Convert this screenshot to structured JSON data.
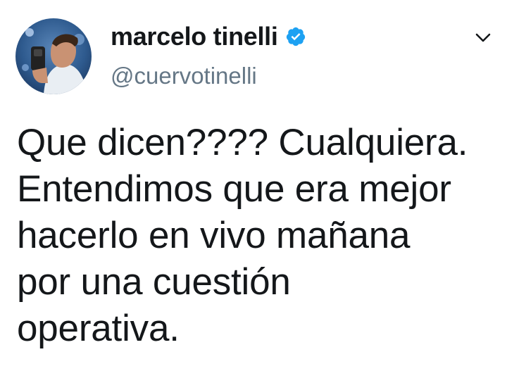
{
  "tweet": {
    "author": {
      "display_name": "marcelo tinelli",
      "handle": "@cuervotinelli",
      "verified": true,
      "avatar_icon": "user-avatar-photo"
    },
    "menu_icon": "chevron-down-icon",
    "text": "Que dicen???? Cualquiera.\nEntendimos que era mejor\nhacerlo en vivo mañana\npor una cuestión\noperativa.",
    "colors": {
      "verified_badge": "#1da1f2",
      "handle": "#657786",
      "text": "#14171a"
    }
  }
}
